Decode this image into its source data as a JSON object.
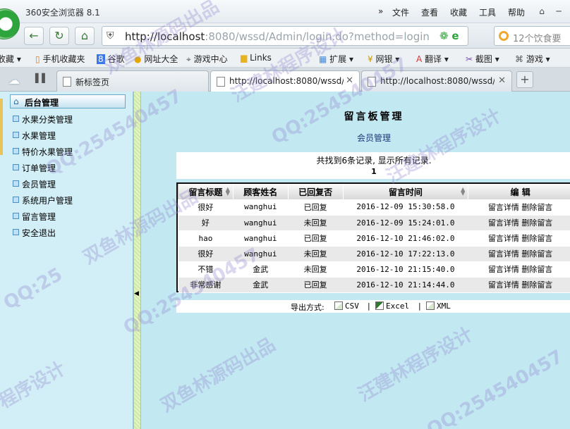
{
  "browser": {
    "title": "360安全浏览器 8.1",
    "menus": [
      "文件",
      "查看",
      "收藏",
      "工具",
      "帮助"
    ],
    "menu_prefix": "»",
    "url_host": "http://localhost",
    "url_rest": ":8080/wssd/Admin/login.do?method=login",
    "search_placeholder": "12个饮食要",
    "bookmarks": [
      "收藏",
      "手机收藏夹",
      "谷歌",
      "网址大全",
      "游戏中心",
      "Links",
      "扩展",
      "网银",
      "翻译",
      "截图",
      "游戏"
    ],
    "tabs": [
      {
        "label": "新标签页"
      },
      {
        "label": "http://localhost:8080/wssd/A"
      },
      {
        "label": "http://localhost:8080/wssd/("
      }
    ],
    "new_tab": "+"
  },
  "sidebar": {
    "header": "后台管理",
    "items": [
      "水果分类管理",
      "水果管理",
      "特价水果管理",
      "订单管理",
      "会员管理",
      "系统用户管理",
      "留言管理",
      "安全退出"
    ]
  },
  "main": {
    "title": "留言板管理",
    "subtitle": "会员管理",
    "record_text": "共找到6条记录, 显示所有记录.",
    "page_number": "1",
    "columns": [
      "留言标题",
      "顾客姓名",
      "已回复否",
      "留言时间",
      "编 辑"
    ],
    "rows": [
      {
        "title": "很好",
        "name": "wanghui",
        "replied": "已回复",
        "time": "2016-12-09 15:30:58.0",
        "detail": "留言详情",
        "delete": "删除留言"
      },
      {
        "title": "好",
        "name": "wanghui",
        "replied": "未回复",
        "time": "2016-12-09 15:24:01.0",
        "detail": "留言详情",
        "delete": "删除留言"
      },
      {
        "title": "hao",
        "name": "wanghui",
        "replied": "已回复",
        "time": "2016-12-10 21:46:02.0",
        "detail": "留言详情",
        "delete": "删除留言"
      },
      {
        "title": "很好",
        "name": "wanghui",
        "replied": "未回复",
        "time": "2016-12-10 17:22:13.0",
        "detail": "留言详情",
        "delete": "删除留言"
      },
      {
        "title": "不错",
        "name": "金武",
        "replied": "未回复",
        "time": "2016-12-10 21:15:40.0",
        "detail": "留言详情",
        "delete": "删除留言"
      },
      {
        "title": "非常感谢",
        "name": "金武",
        "replied": "已回复",
        "time": "2016-12-10 21:14:44.0",
        "detail": "留言详情",
        "delete": "删除留言"
      }
    ],
    "export_label": "导出方式:",
    "export_options": [
      "CSV",
      "Excel",
      "XML"
    ]
  },
  "watermarks": [
    "双鱼林源码出品",
    "QQ:254540457",
    "汪建林程序设计",
    "双鱼林源码出品",
    "QQ:254540457",
    "汪建林程序设计",
    "双鱼林源码出品",
    "QQ:254540457",
    "汪建林程序设计",
    "程序设计",
    "QQ:254540457",
    "QQ:25"
  ],
  "colors": {
    "sidebar_bg": "#d2eef6",
    "main_bg": "#c2e8f1",
    "accent": "#2ea43c"
  }
}
